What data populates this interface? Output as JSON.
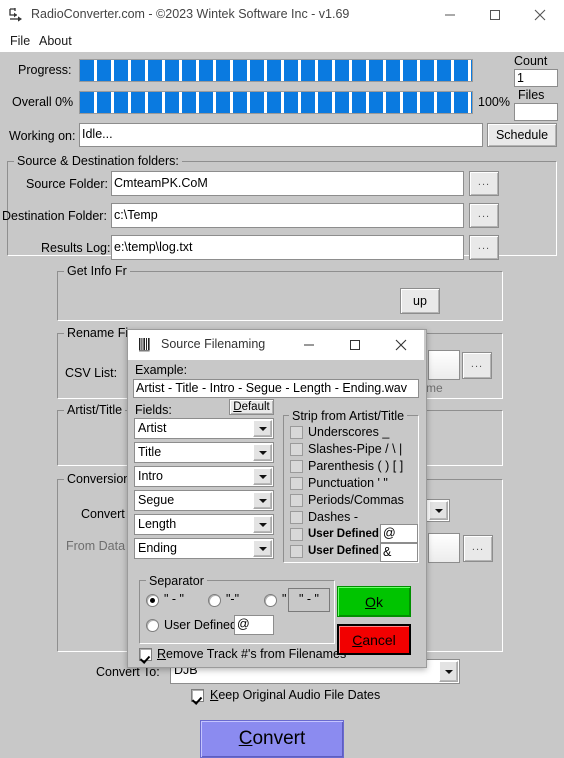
{
  "window": {
    "title": "RadioConverter.com - ©2023 Wintek Software Inc - v1.69",
    "icon": "app-icon",
    "minimize": "–",
    "maximize": "□",
    "close": "✕"
  },
  "menubar": {
    "items": [
      {
        "label": "File"
      },
      {
        "label": "About"
      }
    ]
  },
  "status": {
    "progress_label": "Progress:",
    "overall_label": "Overall 0%",
    "overall_percent_right": "100%",
    "working_label": "Working on:",
    "working_value": "Idle...",
    "schedule_button": "Schedule",
    "count_label": "Count",
    "count_value": "1",
    "files_label": "Files",
    "files_value": "",
    "progress_fill_percent": 100,
    "overall_fill_percent": 100,
    "bar_color": "#0a7ae0"
  },
  "source_dest": {
    "caption": "Source & Destination folders:",
    "rows": [
      {
        "label": "Source Folder:",
        "value": "CmteamPK.CoM",
        "browse": "..."
      },
      {
        "label": "Destination Folder:",
        "value": "c:\\Temp",
        "browse": "..."
      },
      {
        "label": "Results Log:",
        "value": "e:\\temp\\log.txt",
        "browse": "..."
      }
    ]
  },
  "background_groups": [
    {
      "caption": "Get Info Fr"
    },
    {
      "caption": "Rename Fi"
    },
    {
      "caption": "Artist/Title"
    },
    {
      "caption": "Conversion"
    }
  ],
  "background_fields": {
    "csv_list_label": "CSV List:",
    "convert_label": "Convert",
    "from_data_label": "From Data",
    "partial_up_button": "up",
    "partial_me_label": "me",
    "convert_to_label": "Convert To:",
    "convert_to_value": "DJB",
    "keep_dates_label": "Keep Original Audio File Dates",
    "keep_dates_checked": true,
    "browse": "...",
    "convert_button": "Convert"
  },
  "dialog": {
    "title": "Source Filenaming",
    "icon": "barcode-icon",
    "minimize": "–",
    "maximize": "□",
    "close": "✕",
    "example_label": "Example:",
    "example_value": "Artist - Title - Intro - Segue - Length - Ending.wav",
    "fields_label": "Fields:",
    "default_button": "Default",
    "fields": [
      {
        "value": "Artist"
      },
      {
        "value": "Title"
      },
      {
        "value": "Intro"
      },
      {
        "value": "Segue"
      },
      {
        "value": "Length"
      },
      {
        "value": "Ending"
      }
    ],
    "strip_caption": "Strip from Artist/Title",
    "strip_items": [
      {
        "label": "Underscores _",
        "checked": false,
        "input": null
      },
      {
        "label": "Slashes-Pipe / \\ |",
        "checked": false,
        "input": null
      },
      {
        "label": "Parenthesis ( ) [ ]",
        "checked": false,
        "input": null
      },
      {
        "label": "Punctuation ' \"",
        "checked": false,
        "input": null
      },
      {
        "label": "Periods/Commas",
        "checked": false,
        "input": null
      },
      {
        "label": "Dashes -",
        "checked": false,
        "input": null
      },
      {
        "label": "User Defined",
        "checked": false,
        "input": "@"
      },
      {
        "label": "User Defined",
        "checked": false,
        "input": "&"
      }
    ],
    "separator_caption": "Separator",
    "separator_options": [
      {
        "label": "\" - \"",
        "selected": true
      },
      {
        "label": "\"-\"",
        "selected": false
      },
      {
        "label": "\" _ \"",
        "selected": false
      }
    ],
    "separator_preview": "\" - \"",
    "user_defined_label": "User Defined:",
    "user_defined_selected": false,
    "user_defined_value": "@",
    "remove_track_label": "Remove Track #'s from Filenames",
    "remove_track_checked": true,
    "ok_button": "Ok",
    "cancel_button": "Cancel",
    "ok_color": "#00c400",
    "cancel_color": "#f20000"
  }
}
